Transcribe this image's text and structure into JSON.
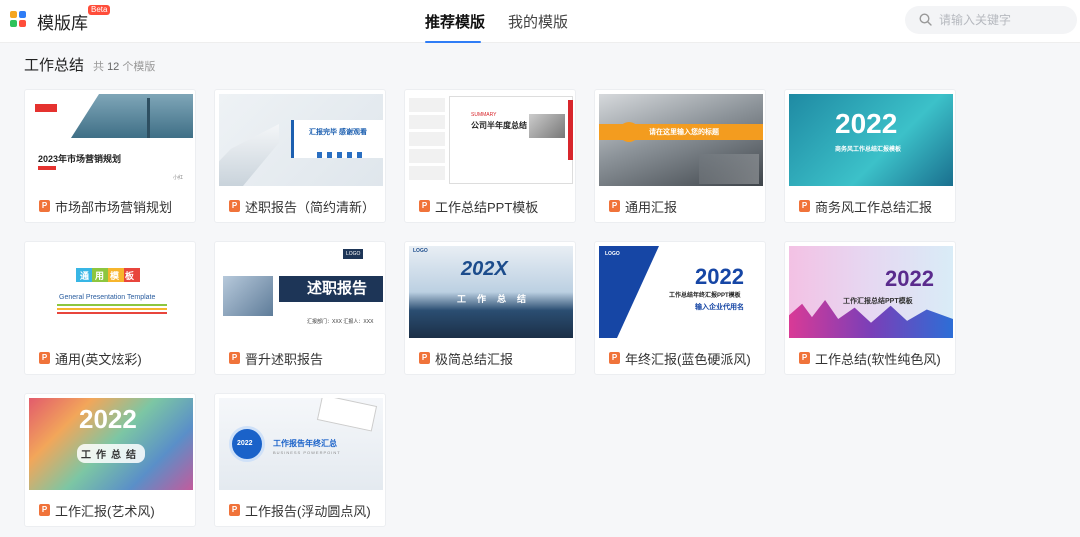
{
  "header": {
    "app_title": "模版库",
    "beta_badge": "Beta",
    "tabs": [
      {
        "label": "推荐模版",
        "active": true
      },
      {
        "label": "我的模版",
        "active": false
      }
    ],
    "search": {
      "placeholder": "请输入关键字",
      "value": ""
    }
  },
  "section": {
    "title": "工作总结",
    "count_prefix": "共",
    "count": "12",
    "count_suffix": "个模版"
  },
  "templates": [
    {
      "name": "市场部市场营销规划",
      "thumb_title": "2023年市场营销规划",
      "thumb_small": "小红"
    },
    {
      "name": "述职报告（简约清新）",
      "thumb_title": "汇报完毕 感谢观看"
    },
    {
      "name": "工作总结PPT模板",
      "thumb_title": "公司半年度总结",
      "thumb_small": "SUMMARY"
    },
    {
      "name": "通用汇报",
      "thumb_title": "请在这里输入您的标题"
    },
    {
      "name": "商务风工作总结汇报",
      "thumb_title": "2022",
      "thumb_sub": "商务风工作总结汇报模板"
    },
    {
      "name": "通用(英文炫彩)",
      "thumb_title": "通用模板",
      "thumb_sub": "General Presentation Template"
    },
    {
      "name": "晋升述职报告",
      "thumb_title": "述职报告",
      "thumb_small": "LOGO",
      "thumb_sub": "汇报部门：XXX   汇报人：XXX"
    },
    {
      "name": "极简总结汇报",
      "thumb_title": "202X",
      "thumb_small": "LOGO",
      "thumb_sub": "工作总结"
    },
    {
      "name": "年终汇报(蓝色硬派风)",
      "thumb_title": "2022",
      "thumb_small": "LOGO",
      "thumb_sub": "工作总结年终汇报PPT模板",
      "thumb_sub2": "输入企业代用名"
    },
    {
      "name": "工作总结(软性纯色风)",
      "thumb_title": "2022",
      "thumb_sub": "工作汇报总结PPT模板"
    },
    {
      "name": "工作汇报(艺术风)",
      "thumb_title": "2022",
      "thumb_sub": "工作总结"
    },
    {
      "name": "工作报告(浮动圆点风)",
      "thumb_title": "工作报告年终汇总",
      "thumb_small": "2022",
      "thumb_sub": "BUSINESS POWERPOINT"
    }
  ],
  "icons": {
    "logo": "app-logo-icon",
    "search": "search-icon",
    "ppt": "ppt-file-icon"
  },
  "colors": {
    "accent": "#2f7df6",
    "beta": "#ff4d3a",
    "ppt_icon": "#f0733a"
  }
}
